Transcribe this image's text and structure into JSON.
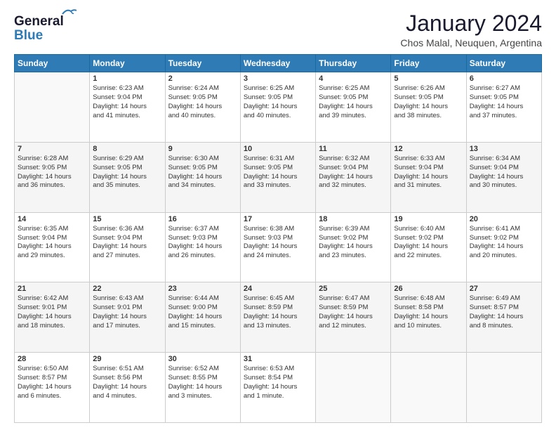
{
  "header": {
    "logo_line1": "General",
    "logo_line2": "Blue",
    "month": "January 2024",
    "location": "Chos Malal, Neuquen, Argentina"
  },
  "days_of_week": [
    "Sunday",
    "Monday",
    "Tuesday",
    "Wednesday",
    "Thursday",
    "Friday",
    "Saturday"
  ],
  "weeks": [
    [
      {
        "day": "",
        "info": ""
      },
      {
        "day": "1",
        "info": "Sunrise: 6:23 AM\nSunset: 9:04 PM\nDaylight: 14 hours\nand 41 minutes."
      },
      {
        "day": "2",
        "info": "Sunrise: 6:24 AM\nSunset: 9:05 PM\nDaylight: 14 hours\nand 40 minutes."
      },
      {
        "day": "3",
        "info": "Sunrise: 6:25 AM\nSunset: 9:05 PM\nDaylight: 14 hours\nand 40 minutes."
      },
      {
        "day": "4",
        "info": "Sunrise: 6:25 AM\nSunset: 9:05 PM\nDaylight: 14 hours\nand 39 minutes."
      },
      {
        "day": "5",
        "info": "Sunrise: 6:26 AM\nSunset: 9:05 PM\nDaylight: 14 hours\nand 38 minutes."
      },
      {
        "day": "6",
        "info": "Sunrise: 6:27 AM\nSunset: 9:05 PM\nDaylight: 14 hours\nand 37 minutes."
      }
    ],
    [
      {
        "day": "7",
        "info": "Sunrise: 6:28 AM\nSunset: 9:05 PM\nDaylight: 14 hours\nand 36 minutes."
      },
      {
        "day": "8",
        "info": "Sunrise: 6:29 AM\nSunset: 9:05 PM\nDaylight: 14 hours\nand 35 minutes."
      },
      {
        "day": "9",
        "info": "Sunrise: 6:30 AM\nSunset: 9:05 PM\nDaylight: 14 hours\nand 34 minutes."
      },
      {
        "day": "10",
        "info": "Sunrise: 6:31 AM\nSunset: 9:05 PM\nDaylight: 14 hours\nand 33 minutes."
      },
      {
        "day": "11",
        "info": "Sunrise: 6:32 AM\nSunset: 9:04 PM\nDaylight: 14 hours\nand 32 minutes."
      },
      {
        "day": "12",
        "info": "Sunrise: 6:33 AM\nSunset: 9:04 PM\nDaylight: 14 hours\nand 31 minutes."
      },
      {
        "day": "13",
        "info": "Sunrise: 6:34 AM\nSunset: 9:04 PM\nDaylight: 14 hours\nand 30 minutes."
      }
    ],
    [
      {
        "day": "14",
        "info": "Sunrise: 6:35 AM\nSunset: 9:04 PM\nDaylight: 14 hours\nand 29 minutes."
      },
      {
        "day": "15",
        "info": "Sunrise: 6:36 AM\nSunset: 9:04 PM\nDaylight: 14 hours\nand 27 minutes."
      },
      {
        "day": "16",
        "info": "Sunrise: 6:37 AM\nSunset: 9:03 PM\nDaylight: 14 hours\nand 26 minutes."
      },
      {
        "day": "17",
        "info": "Sunrise: 6:38 AM\nSunset: 9:03 PM\nDaylight: 14 hours\nand 24 minutes."
      },
      {
        "day": "18",
        "info": "Sunrise: 6:39 AM\nSunset: 9:02 PM\nDaylight: 14 hours\nand 23 minutes."
      },
      {
        "day": "19",
        "info": "Sunrise: 6:40 AM\nSunset: 9:02 PM\nDaylight: 14 hours\nand 22 minutes."
      },
      {
        "day": "20",
        "info": "Sunrise: 6:41 AM\nSunset: 9:02 PM\nDaylight: 14 hours\nand 20 minutes."
      }
    ],
    [
      {
        "day": "21",
        "info": "Sunrise: 6:42 AM\nSunset: 9:01 PM\nDaylight: 14 hours\nand 18 minutes."
      },
      {
        "day": "22",
        "info": "Sunrise: 6:43 AM\nSunset: 9:01 PM\nDaylight: 14 hours\nand 17 minutes."
      },
      {
        "day": "23",
        "info": "Sunrise: 6:44 AM\nSunset: 9:00 PM\nDaylight: 14 hours\nand 15 minutes."
      },
      {
        "day": "24",
        "info": "Sunrise: 6:45 AM\nSunset: 8:59 PM\nDaylight: 14 hours\nand 13 minutes."
      },
      {
        "day": "25",
        "info": "Sunrise: 6:47 AM\nSunset: 8:59 PM\nDaylight: 14 hours\nand 12 minutes."
      },
      {
        "day": "26",
        "info": "Sunrise: 6:48 AM\nSunset: 8:58 PM\nDaylight: 14 hours\nand 10 minutes."
      },
      {
        "day": "27",
        "info": "Sunrise: 6:49 AM\nSunset: 8:57 PM\nDaylight: 14 hours\nand 8 minutes."
      }
    ],
    [
      {
        "day": "28",
        "info": "Sunrise: 6:50 AM\nSunset: 8:57 PM\nDaylight: 14 hours\nand 6 minutes."
      },
      {
        "day": "29",
        "info": "Sunrise: 6:51 AM\nSunset: 8:56 PM\nDaylight: 14 hours\nand 4 minutes."
      },
      {
        "day": "30",
        "info": "Sunrise: 6:52 AM\nSunset: 8:55 PM\nDaylight: 14 hours\nand 3 minutes."
      },
      {
        "day": "31",
        "info": "Sunrise: 6:53 AM\nSunset: 8:54 PM\nDaylight: 14 hours\nand 1 minute."
      },
      {
        "day": "",
        "info": ""
      },
      {
        "day": "",
        "info": ""
      },
      {
        "day": "",
        "info": ""
      }
    ]
  ]
}
